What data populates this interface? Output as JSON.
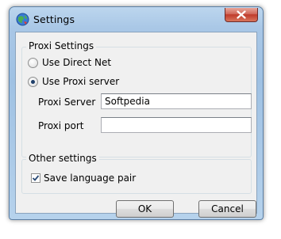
{
  "window": {
    "title": "Settings"
  },
  "proxi_settings": {
    "legend": "Proxi Settings",
    "radio_direct": {
      "label": "Use Direct Net",
      "checked": false
    },
    "radio_proxi": {
      "label": "Use Proxi server",
      "checked": true
    },
    "server": {
      "label": "Proxi Server",
      "value": "Softpedia"
    },
    "port": {
      "label": "Proxi port",
      "value": ""
    }
  },
  "other_settings": {
    "legend": "Other settings",
    "save_language_pair": {
      "label": "Save language pair",
      "checked": true
    }
  },
  "buttons": {
    "ok": "OK",
    "cancel": "Cancel"
  }
}
